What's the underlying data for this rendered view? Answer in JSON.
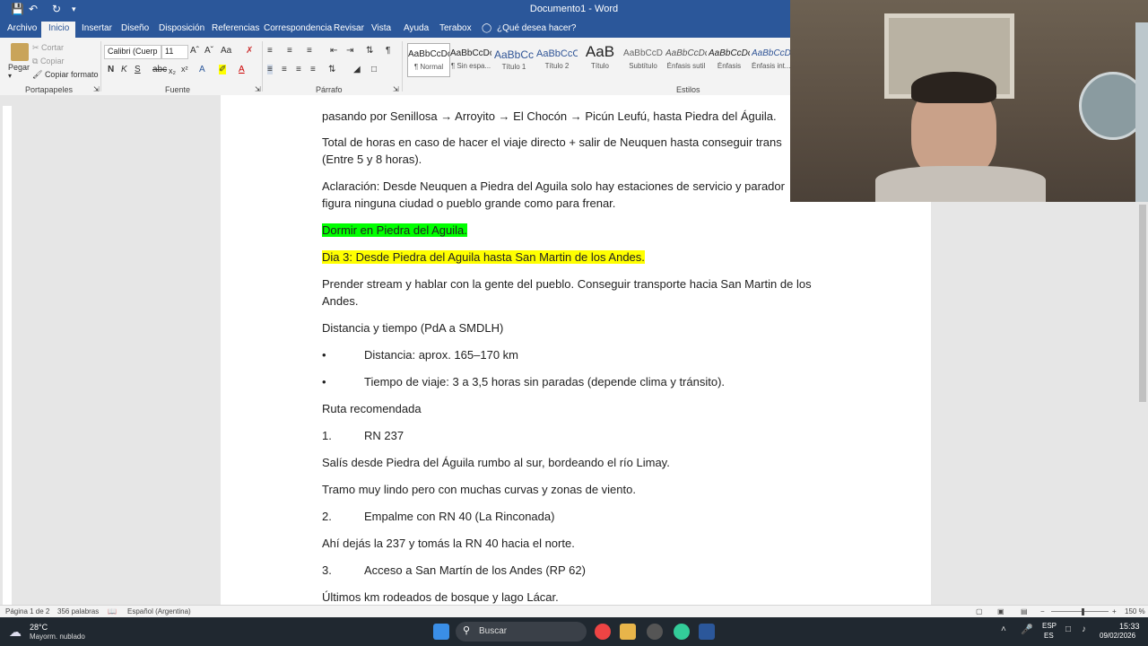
{
  "window": {
    "title": "Documento1 - Word",
    "qat": [
      "save-icon",
      "undo-icon",
      "redo-icon",
      "customize-icon"
    ]
  },
  "tabs": [
    "Archivo",
    "Inicio",
    "Insertar",
    "Diseño",
    "Disposición",
    "Referencias",
    "Correspondencia",
    "Revisar",
    "Vista",
    "Ayuda",
    "Terabox"
  ],
  "tell_me": "¿Qué desea hacer?",
  "ribbon": {
    "clipboard": {
      "paste": "Pegar",
      "cut": "Cortar",
      "copy": "Copiar",
      "format_painter": "Copiar formato",
      "group": "Portapapeles"
    },
    "font": {
      "name": "Calibri (Cuerp",
      "size": "11",
      "group": "Fuente"
    },
    "paragraph": {
      "group": "Párrafo"
    },
    "styles": {
      "group": "Estilos",
      "items": [
        {
          "preview": "AaBbCcDc",
          "name": "¶ Normal"
        },
        {
          "preview": "AaBbCcDc",
          "name": "¶ Sin espa..."
        },
        {
          "preview": "AaBbCc",
          "name": "Título 1"
        },
        {
          "preview": "AaBbCcC",
          "name": "Título 2"
        },
        {
          "preview": "AaB",
          "name": "Título"
        },
        {
          "preview": "AaBbCcD",
          "name": "Subtítulo"
        },
        {
          "preview": "AaBbCcDc",
          "name": "Énfasis sutil"
        },
        {
          "preview": "AaBbCcDc",
          "name": "Énfasis"
        },
        {
          "preview": "AaBbCcDc",
          "name": "Énfasis int..."
        }
      ]
    }
  },
  "document": {
    "line1": "pasando por Senillosa → Arroyito → El Chocón → Picún Leufú, hasta Piedra del Águila.",
    "line2": "Total de horas en caso de hacer el viaje directo + salir de Neuquen hasta conseguir trans",
    "line3": "(Entre 5 y 8 horas).",
    "line4": "Aclaración: Desde Neuquen a Piedra del Aguila solo hay estaciones de servicio y parador",
    "line5": "figura ninguna ciudad o pueblo grande como para frenar.",
    "line6": "Dormir en Piedra del Aguila.",
    "line7": "Dia 3: Desde Piedra del Aguila hasta San Martin de los Andes.",
    "line8": "Prender stream y hablar con la gente del pueblo. Conseguir transporte hacia San Martin de los",
    "line9": "Andes.",
    "line10": "Distancia y tiempo (PdA a SMDLH)",
    "bullet_char": "•",
    "bullet1": "Distancia: aprox. 165–170 km",
    "bullet2": "Tiempo de viaje: 3 a 3,5 horas sin paradas (depende clima y tránsito).",
    "line11": "Ruta recomendada",
    "n1": "1.",
    "n1text": "RN 237",
    "line12": "Salís desde Piedra del Águila rumbo al sur, bordeando el río Limay.",
    "line13": " Tramo muy lindo pero con muchas curvas y zonas de viento.",
    "n2": "2.",
    "n2text": "Empalme con RN 40 (La Rinconada)",
    "line14": "Ahí dejás la 237 y tomás la RN 40 hacia el norte.",
    "n3": "3.",
    "n3text": "Acceso a San Martín de los Andes (RP 62)",
    "line15": "Últimos km rodeados de bosque y lago Lácar."
  },
  "status": {
    "page": "Página 1 de 2",
    "words": "356 palabras",
    "language": "Español (Argentina)",
    "zoom": "150 %"
  },
  "taskbar": {
    "weather_temp": "28°C",
    "weather_desc": "Mayorm. nublado",
    "search": "Buscar",
    "lang1": "ESP",
    "lang2": "ES",
    "time": "15:33",
    "date": "09/02/2026"
  },
  "colors": {
    "word_blue": "#2b579a",
    "green_highlight": "#00ff00",
    "yellow_highlight": "#ffff00"
  }
}
